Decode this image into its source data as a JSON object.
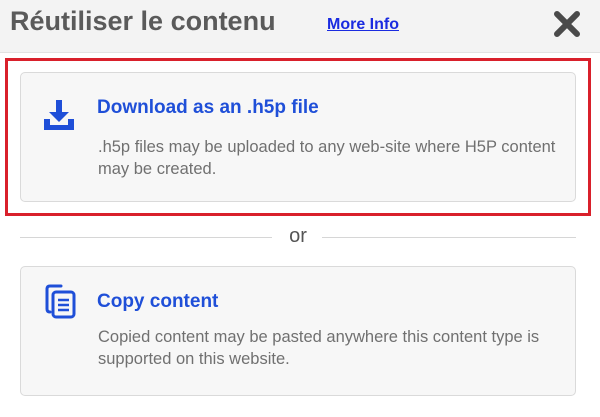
{
  "header": {
    "title": "Réutiliser le contenu",
    "more_info": "More Info",
    "close_icon": "close-icon"
  },
  "options": [
    {
      "icon": "download-icon",
      "title": "Download as an .h5p file",
      "description": ".h5p files may be uploaded to any web-site where H5P content may be created."
    },
    {
      "icon": "copy-icon",
      "title": "Copy content",
      "description": "Copied content may be pasted anywhere this content type is supported on this website."
    }
  ],
  "separator": {
    "text": "or"
  },
  "colors": {
    "accent": "#1f4fd8",
    "link": "#1a2be0",
    "highlight_border": "#d9202b",
    "header_bg": "#f3f3f3"
  }
}
